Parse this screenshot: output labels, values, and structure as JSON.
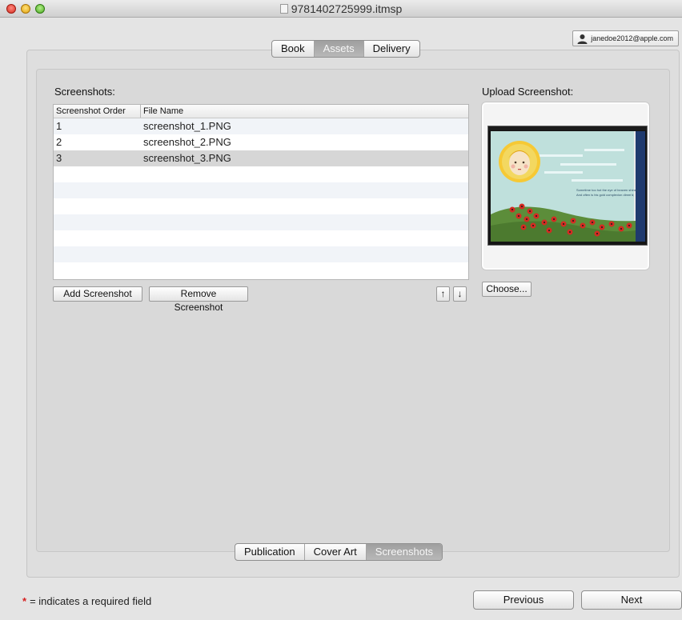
{
  "window": {
    "title": "9781402725999.itmsp"
  },
  "account": {
    "email": "janedoe2012@apple.com"
  },
  "top_tabs": [
    {
      "label": "Book",
      "active": false
    },
    {
      "label": "Assets",
      "active": true
    },
    {
      "label": "Delivery",
      "active": false
    }
  ],
  "screenshots": {
    "heading": "Screenshots:",
    "columns": {
      "order": "Screenshot Order",
      "file_name": "File Name"
    },
    "rows": [
      {
        "order": "1",
        "file_name": "screenshot_1.PNG",
        "selected": false
      },
      {
        "order": "2",
        "file_name": "screenshot_2.PNG",
        "selected": false
      },
      {
        "order": "3",
        "file_name": "screenshot_3.PNG",
        "selected": true
      }
    ],
    "add_label": "Add Screenshot",
    "remove_label": "Remove Screenshot",
    "move_up_label": "↑",
    "move_down_label": "↓"
  },
  "upload": {
    "heading": "Upload Screenshot:",
    "choose_label": "Choose...",
    "preview_caption_line1": "Sometime too hot the eye of heaven shines,",
    "preview_caption_line2": "And often is his gold complexion dimm'd;"
  },
  "bottom_tabs": [
    {
      "label": "Publication",
      "active": false
    },
    {
      "label": "Cover Art",
      "active": false
    },
    {
      "label": "Screenshots",
      "active": true
    }
  ],
  "footer": {
    "required_star": "*",
    "required_text": "= indicates a required field",
    "previous_label": "Previous",
    "next_label": "Next"
  },
  "colors": {
    "accent_red": "#d62020",
    "selected_row": "#d6d6d6",
    "active_segment": "#a9a9a9"
  }
}
